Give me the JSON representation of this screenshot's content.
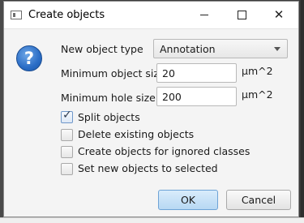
{
  "window": {
    "title": "Create objects"
  },
  "form": {
    "object_type": {
      "label": "New object type",
      "value": "Annotation"
    },
    "min_object_size": {
      "label": "Minimum object size",
      "value": "20",
      "unit": "µm^2"
    },
    "min_hole_size": {
      "label": "Minimum hole size",
      "value": "200",
      "unit": "µm^2"
    }
  },
  "options": [
    {
      "label": "Split objects",
      "checked": true
    },
    {
      "label": "Delete existing objects",
      "checked": false
    },
    {
      "label": "Create objects for ignored classes",
      "checked": false
    },
    {
      "label": "Set new objects to selected",
      "checked": false
    }
  ],
  "buttons": {
    "ok": "OK",
    "cancel": "Cancel"
  },
  "icons": {
    "dialog": "question-icon",
    "close_glyph": "✕",
    "check_glyph": "✓"
  },
  "colors": {
    "accent": "#2a6dc6",
    "ok_button": "#b7d8f3"
  }
}
